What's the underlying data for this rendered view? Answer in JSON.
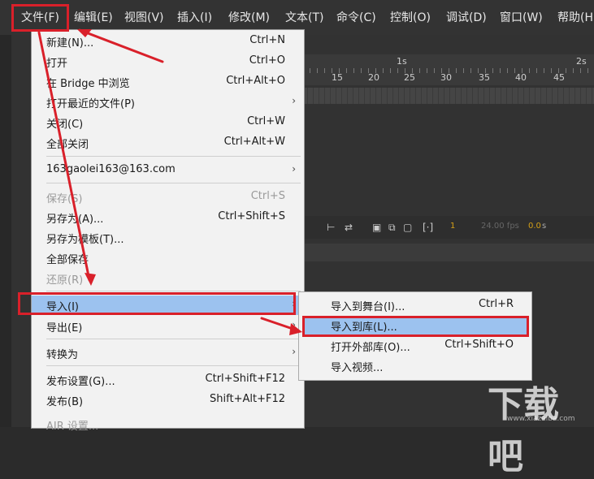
{
  "menubar": {
    "items": [
      "文件(F)",
      "编辑(E)",
      "视图(V)",
      "插入(I)",
      "修改(M)",
      "文本(T)",
      "命令(C)",
      "控制(O)",
      "调试(D)",
      "窗口(W)",
      "帮助(H)"
    ]
  },
  "timeline": {
    "ruler_seconds": [
      "1s",
      "2s"
    ],
    "ruler_frames": [
      "15",
      "20",
      "25",
      "30",
      "35",
      "40",
      "45"
    ],
    "frame_number": "1",
    "fps": "24.00 fps",
    "time": "0.0",
    "time_unit": "s"
  },
  "file_menu": {
    "items": [
      {
        "label": "新建(N)...",
        "shortcut": "Ctrl+N"
      },
      {
        "label": "打开",
        "shortcut": "Ctrl+O"
      },
      {
        "label": "在 Bridge 中浏览",
        "shortcut": "Ctrl+Alt+O"
      },
      {
        "label": "打开最近的文件(P)",
        "shortcut": ""
      },
      {
        "label": "关闭(C)",
        "shortcut": "Ctrl+W"
      },
      {
        "label": "全部关闭",
        "shortcut": "Ctrl+Alt+W"
      },
      {
        "label": "163gaolei163@163.com",
        "shortcut": ""
      },
      {
        "label": "保存(S)",
        "shortcut": "Ctrl+S"
      },
      {
        "label": "另存为(A)...",
        "shortcut": "Ctrl+Shift+S"
      },
      {
        "label": "另存为模板(T)...",
        "shortcut": ""
      },
      {
        "label": "全部保存",
        "shortcut": ""
      },
      {
        "label": "还原(R)",
        "shortcut": ""
      },
      {
        "label": "导入(I)",
        "shortcut": ""
      },
      {
        "label": "导出(E)",
        "shortcut": ""
      },
      {
        "label": "转换为",
        "shortcut": ""
      },
      {
        "label": "发布设置(G)...",
        "shortcut": "Ctrl+Shift+F12"
      },
      {
        "label": "发布(B)",
        "shortcut": "Shift+Alt+F12"
      },
      {
        "label": "AIR 设置...",
        "shortcut": ""
      }
    ]
  },
  "import_submenu": {
    "items": [
      {
        "label": "导入到舞台(I)...",
        "shortcut": "Ctrl+R"
      },
      {
        "label": "导入到库(L)...",
        "shortcut": ""
      },
      {
        "label": "打开外部库(O)...",
        "shortcut": "Ctrl+Shift+O"
      },
      {
        "label": "导入视频...",
        "shortcut": ""
      }
    ]
  },
  "watermark": {
    "logo": "下载吧",
    "url": "www.xiazaiba.com"
  },
  "colors": {
    "highlight": "#9cc2ef",
    "annotation": "#d9202a",
    "menu_bg": "#f2f2f2",
    "app_bg": "#323232"
  }
}
